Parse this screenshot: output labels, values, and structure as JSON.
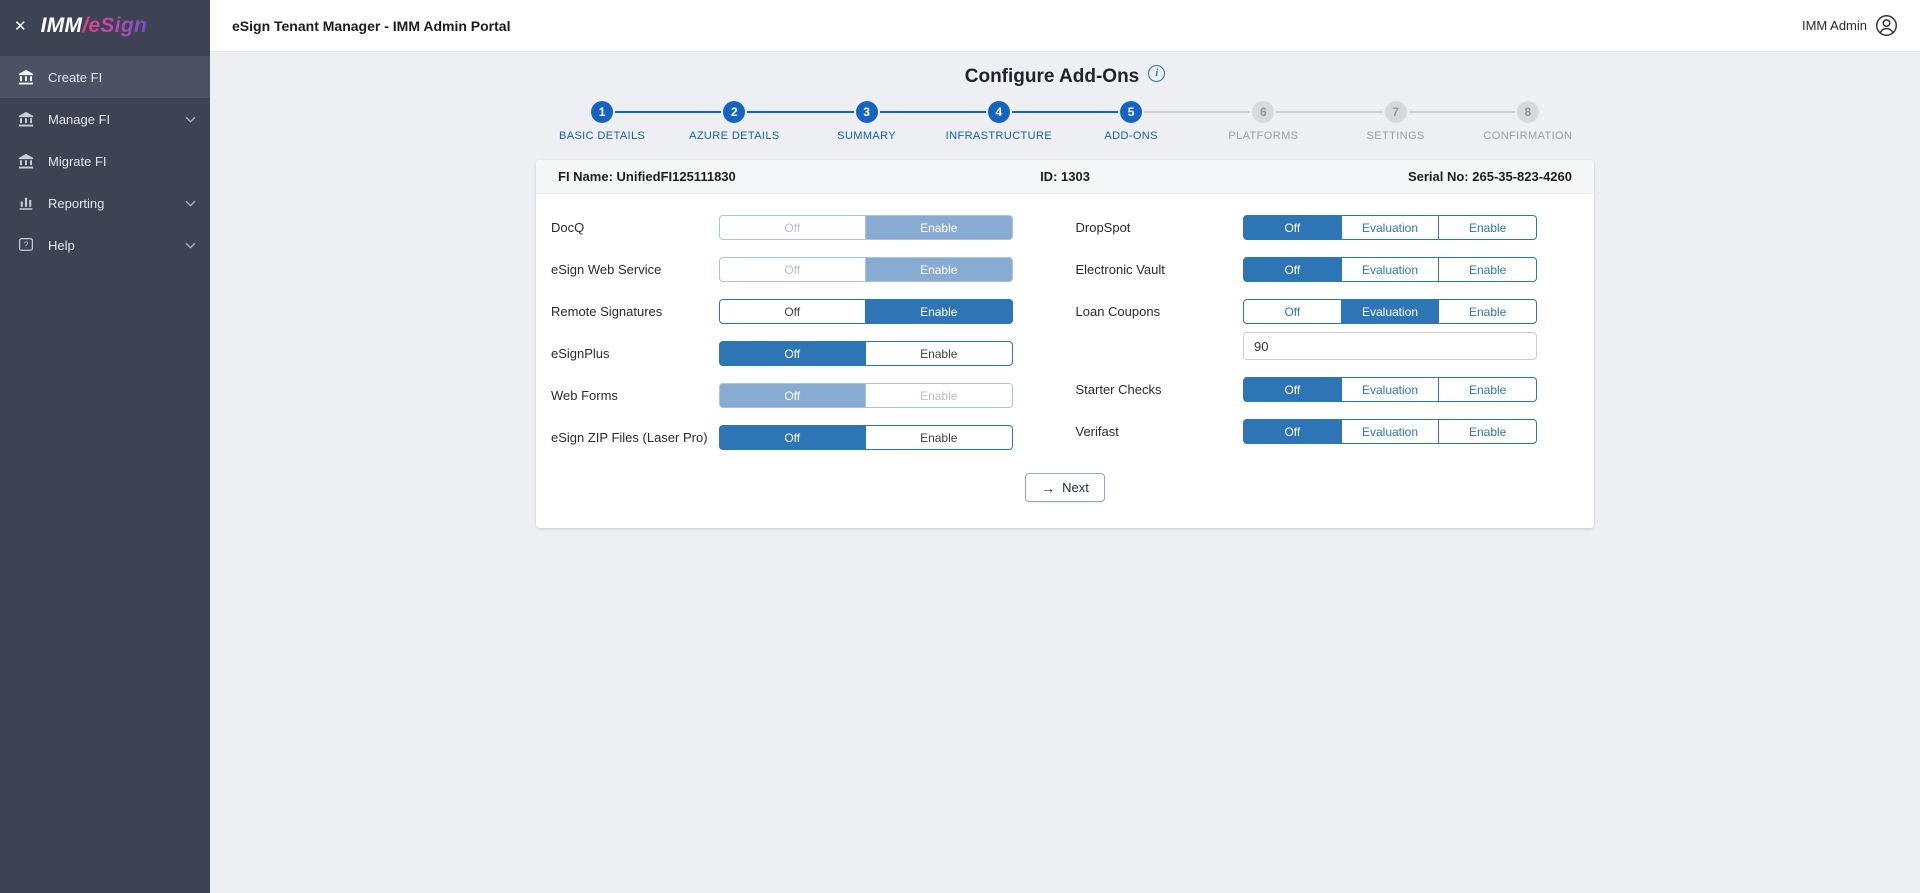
{
  "colors": {
    "accent": "#2e75b6",
    "stepper_active": "#1565c0",
    "sidebar_bg": "#3e4353",
    "disabled_selected": "#87abd1"
  },
  "icons": {
    "close": "✕",
    "info": "i",
    "arrow_right": "→"
  },
  "sidebar": {
    "logo": {
      "imm": "IMM",
      "esign": "/eSign"
    },
    "items": [
      {
        "label": "Create FI",
        "icon": "bank-icon",
        "active": true,
        "chevron": false
      },
      {
        "label": "Manage FI",
        "icon": "bank-icon",
        "active": false,
        "chevron": true
      },
      {
        "label": "Migrate FI",
        "icon": "bank-icon",
        "active": false,
        "chevron": false
      },
      {
        "label": "Reporting",
        "icon": "chart-icon",
        "active": false,
        "chevron": true
      },
      {
        "label": "Help",
        "icon": "help-icon",
        "active": false,
        "chevron": true
      }
    ]
  },
  "header": {
    "title": "eSign Tenant Manager - IMM Admin Portal",
    "user": "IMM Admin"
  },
  "page": {
    "title": "Configure Add-Ons"
  },
  "stepper": {
    "steps": [
      {
        "num": "1",
        "label": "BASIC DETAILS",
        "state": "done"
      },
      {
        "num": "2",
        "label": "AZURE DETAILS",
        "state": "done"
      },
      {
        "num": "3",
        "label": "SUMMARY",
        "state": "done"
      },
      {
        "num": "4",
        "label": "INFRASTRUCTURE",
        "state": "done"
      },
      {
        "num": "5",
        "label": "ADD-ONS",
        "state": "current"
      },
      {
        "num": "6",
        "label": "PLATFORMS",
        "state": "todo"
      },
      {
        "num": "7",
        "label": "SETTINGS",
        "state": "todo"
      },
      {
        "num": "8",
        "label": "CONFIRMATION",
        "state": "todo"
      }
    ]
  },
  "card": {
    "fi_name": "FI Name: UnifiedFI125111830",
    "id": "ID: 1303",
    "serial": "Serial No: 265-35-823-4260",
    "left_addons": [
      {
        "name": "DocQ",
        "options": [
          "Off",
          "Enable"
        ],
        "selected": "Enable",
        "disabled": true
      },
      {
        "name": "eSign Web Service",
        "options": [
          "Off",
          "Enable"
        ],
        "selected": "Enable",
        "disabled": true
      },
      {
        "name": "Remote Signatures",
        "options": [
          "Off",
          "Enable"
        ],
        "selected": "Enable",
        "disabled": false
      },
      {
        "name": "eSignPlus",
        "options": [
          "Off",
          "Enable"
        ],
        "selected": "Off",
        "disabled": false
      },
      {
        "name": "Web Forms",
        "options": [
          "Off",
          "Enable"
        ],
        "selected": "Off",
        "disabled": true
      },
      {
        "name": "eSign ZIP Files (Laser Pro)",
        "options": [
          "Off",
          "Enable"
        ],
        "selected": "Off",
        "disabled": false
      }
    ],
    "right_addons": [
      {
        "name": "DropSpot",
        "options": [
          "Off",
          "Evaluation",
          "Enable"
        ],
        "selected": "Off",
        "disabled": false
      },
      {
        "name": "Electronic Vault",
        "options": [
          "Off",
          "Evaluation",
          "Enable"
        ],
        "selected": "Off",
        "disabled": false
      },
      {
        "name": "Loan Coupons",
        "options": [
          "Off",
          "Evaluation",
          "Enable"
        ],
        "selected": "Evaluation",
        "disabled": false,
        "input_value": "90"
      },
      {
        "name": "Starter Checks",
        "options": [
          "Off",
          "Evaluation",
          "Enable"
        ],
        "selected": "Off",
        "disabled": false
      },
      {
        "name": "Verifast",
        "options": [
          "Off",
          "Evaluation",
          "Enable"
        ],
        "selected": "Off",
        "disabled": false
      }
    ],
    "next_label": "Next"
  }
}
